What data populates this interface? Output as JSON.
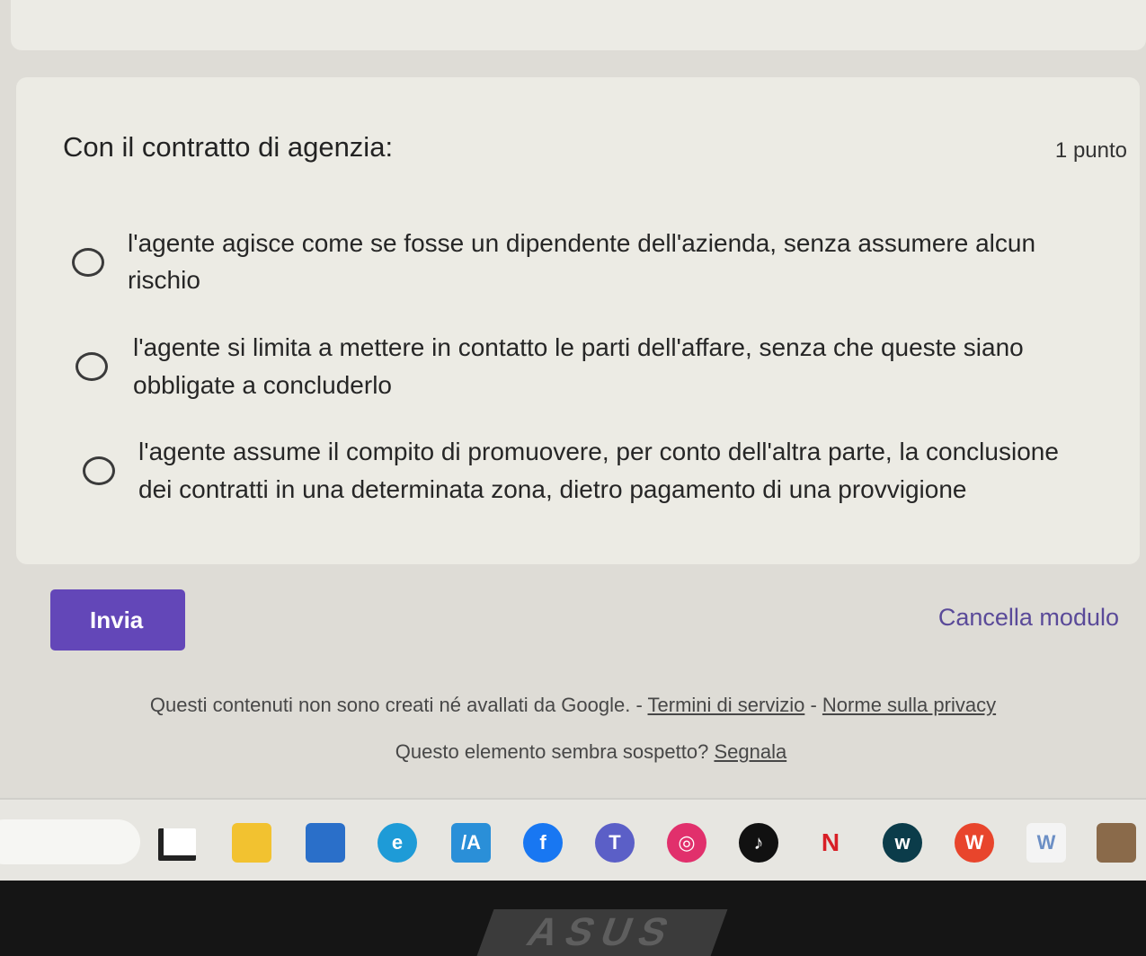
{
  "question": {
    "title": "Con il contratto di agenzia:",
    "points": "1 punto",
    "options": [
      {
        "line1": "l'agente agisce come se fosse un dipendente dell'azienda, senza assumere alcun",
        "line2": "rischio"
      },
      {
        "line1": "l'agente si limita a mettere in contatto le parti dell'affare, senza che queste siano",
        "line2": "obbligate a concluderlo"
      },
      {
        "line1": "l'agente assume il compito di promuovere, per conto dell'altra parte, la conclusione",
        "line2": "dei contratti in una determinata zona, dietro pagamento di una provvigione"
      }
    ]
  },
  "actions": {
    "submit_label": "Invia",
    "clear_label": "Cancella modulo"
  },
  "footer": {
    "disclaimer": "Questi contenuti non sono creati né avallati da Google. -",
    "sep": "-",
    "terms": "Termini di servizio",
    "privacy": "Norme sulla privacy",
    "report_question": "Questo elemento sembra sospetto?",
    "report_link": "Segnala"
  },
  "taskbar": {
    "icons": [
      {
        "name": "start-icon",
        "color": "#ffffff",
        "glyph": ""
      },
      {
        "name": "file-explorer-icon",
        "color": "#f2c230",
        "glyph": ""
      },
      {
        "name": "microsoft-store-icon",
        "color": "#2a6fc9",
        "glyph": ""
      },
      {
        "name": "edge-icon",
        "color": "#1e9bd7",
        "glyph": "e"
      },
      {
        "name": "app-ma-icon",
        "color": "#2a8fd8",
        "glyph": "/A"
      },
      {
        "name": "facebook-icon",
        "color": "#1877f2",
        "glyph": "f"
      },
      {
        "name": "teams-icon",
        "color": "#5b5fc7",
        "glyph": "T"
      },
      {
        "name": "instagram-icon",
        "color": "#e1306c",
        "glyph": "◎"
      },
      {
        "name": "tiktok-icon",
        "color": "#111111",
        "glyph": "♪"
      },
      {
        "name": "netflix-icon",
        "color": "#e7e6e1",
        "glyph": "N"
      },
      {
        "name": "watchparty-icon",
        "color": "#0b3c4a",
        "glyph": "w"
      },
      {
        "name": "wps-office-icon",
        "color": "#e8452c",
        "glyph": "W"
      },
      {
        "name": "whiteboard-icon",
        "color": "#f4f4f4",
        "glyph": "W"
      },
      {
        "name": "game-icon",
        "color": "#8a6a4a",
        "glyph": ""
      }
    ]
  },
  "bezel": {
    "brand": "ASUS"
  }
}
